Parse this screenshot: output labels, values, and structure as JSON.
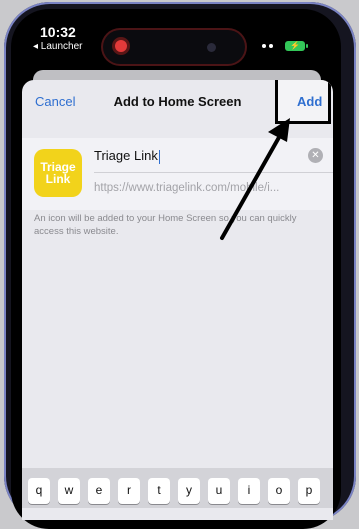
{
  "status": {
    "time": "10:32",
    "back_app": "◂ Launcher",
    "battery": "⚡"
  },
  "sheet": {
    "cancel_label": "Cancel",
    "title": "Add to Home Screen",
    "add_label": "Add"
  },
  "app": {
    "icon_text_line1": "Triage",
    "icon_text_line2": "Link",
    "name_value": "Triage Link",
    "url": "https://www.triagelink.com/mobile/i...",
    "hint": "An icon will be added to your Home Screen so you can quickly access this website."
  },
  "keyboard": {
    "keys": [
      "q",
      "w",
      "e",
      "r",
      "t",
      "y",
      "u",
      "i",
      "o",
      "p"
    ]
  },
  "colors": {
    "accent": "#2f6fd0",
    "icon_bg": "#f2d31b",
    "sheet_bg": "#e9e9ee"
  }
}
